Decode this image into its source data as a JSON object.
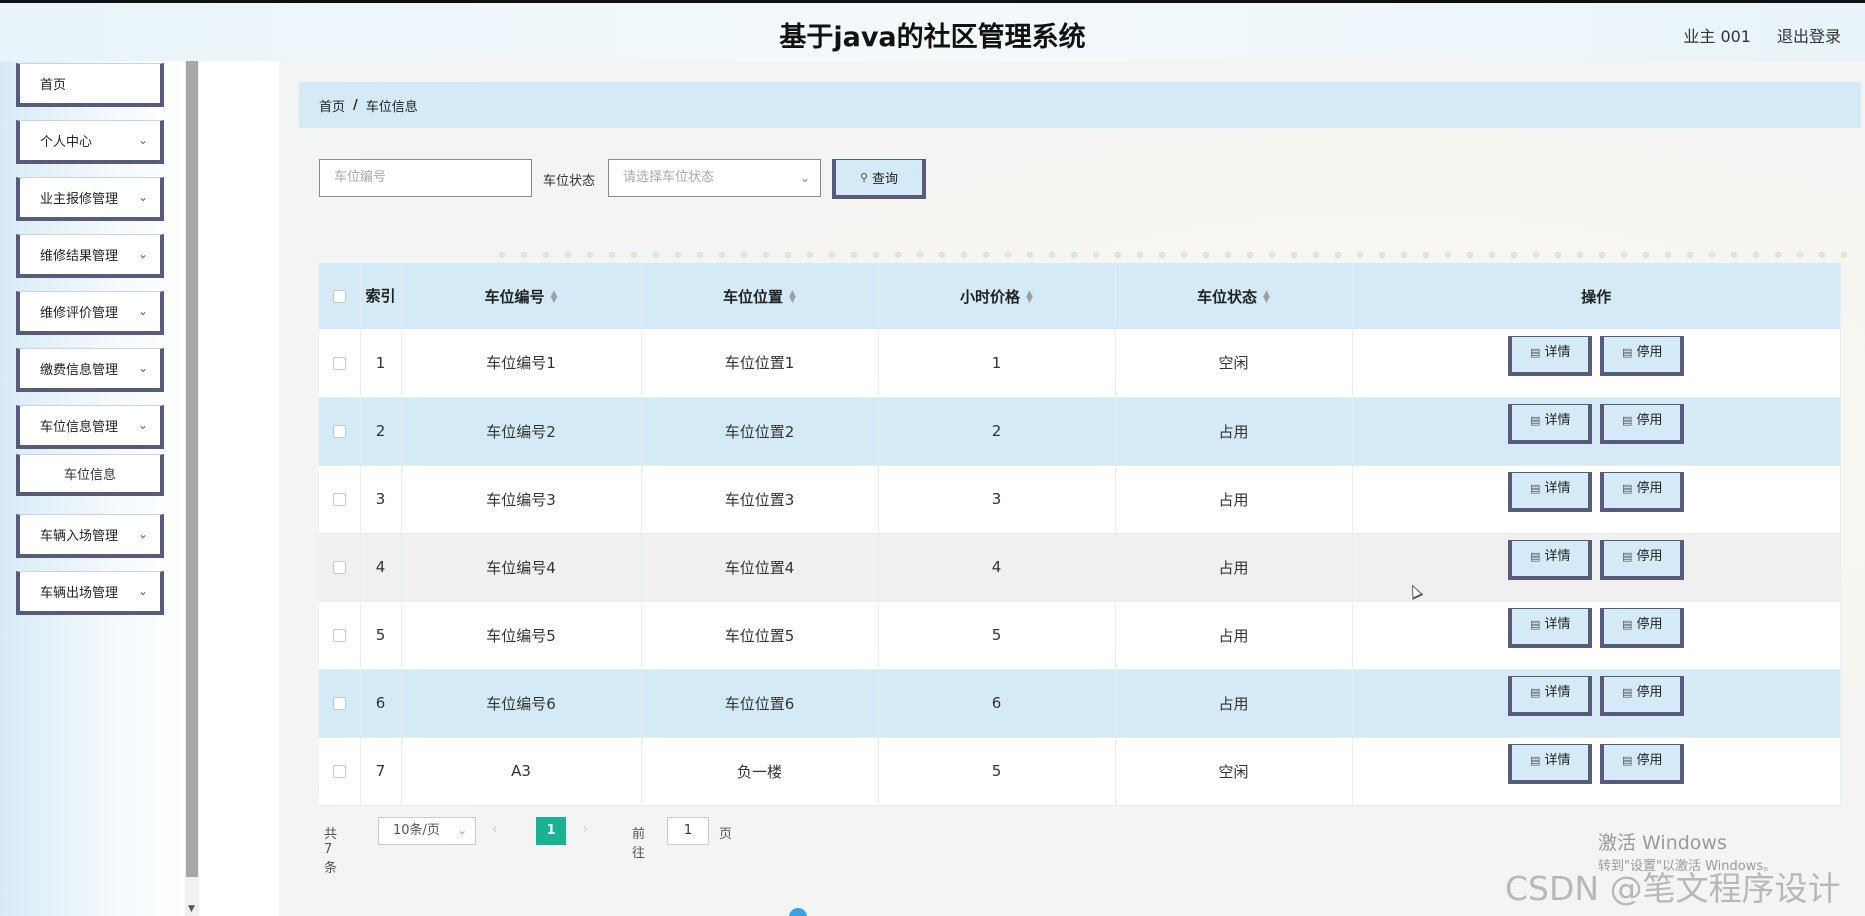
{
  "header": {
    "title": "基于java的社区管理系统",
    "user": "业主 001",
    "logout": "退出登录"
  },
  "sidebar": {
    "items": [
      {
        "label": "首页",
        "expandable": false
      },
      {
        "label": "个人中心",
        "expandable": true
      },
      {
        "label": "业主报修管理",
        "expandable": true
      },
      {
        "label": "维修结果管理",
        "expandable": true
      },
      {
        "label": "维修评价管理",
        "expandable": true
      },
      {
        "label": "缴费信息管理",
        "expandable": true
      },
      {
        "label": "车位信息管理",
        "expandable": true
      },
      {
        "label": "车辆入场管理",
        "expandable": true
      },
      {
        "label": "车辆出场管理",
        "expandable": true
      }
    ],
    "sub_item": "车位信息"
  },
  "breadcrumb": {
    "home": "首页",
    "separator": "/",
    "current": "车位信息"
  },
  "search": {
    "number_placeholder": "车位编号",
    "status_label": "车位状态",
    "status_placeholder": "请选择车位状态",
    "query_label": "查询"
  },
  "table": {
    "headers": {
      "index": "索引",
      "number": "车位编号",
      "location": "车位位置",
      "price": "小时价格",
      "status": "车位状态",
      "actions": "操作"
    },
    "rows": [
      {
        "index": "1",
        "number": "车位编号1",
        "location": "车位位置1",
        "price": "1",
        "status": "空闲"
      },
      {
        "index": "2",
        "number": "车位编号2",
        "location": "车位位置2",
        "price": "2",
        "status": "占用"
      },
      {
        "index": "3",
        "number": "车位编号3",
        "location": "车位位置3",
        "price": "3",
        "status": "占用"
      },
      {
        "index": "4",
        "number": "车位编号4",
        "location": "车位位置4",
        "price": "4",
        "status": "占用"
      },
      {
        "index": "5",
        "number": "车位编号5",
        "location": "车位位置5",
        "price": "5",
        "status": "占用"
      },
      {
        "index": "6",
        "number": "车位编号6",
        "location": "车位位置6",
        "price": "6",
        "status": "占用"
      },
      {
        "index": "7",
        "number": "A3",
        "location": "负一楼",
        "price": "5",
        "status": "空闲"
      }
    ],
    "detail_label": "详情",
    "disable_label": "停用"
  },
  "pagination": {
    "total": "共 7 条",
    "page_size": "10条/页",
    "current_page": "1",
    "goto_label": "前往",
    "goto_value": "1",
    "page_suffix": "页"
  },
  "overlay": {
    "activate_title": "激活 Windows",
    "activate_sub": "转到\"设置\"以激活 Windows。",
    "brand": "CSDN @笔文程序设计"
  },
  "colors": {
    "accent_blue": "#d4ebf7",
    "button_border": "#585b7c",
    "pager_active": "#19b394"
  }
}
